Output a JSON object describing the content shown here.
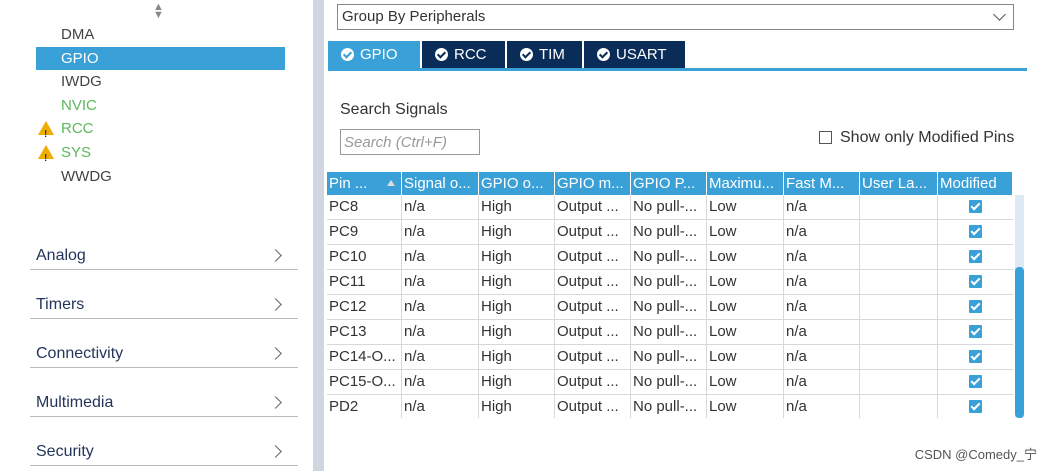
{
  "left": {
    "peripherals": [
      {
        "label": "DMA",
        "state": "normal"
      },
      {
        "label": "GPIO",
        "state": "selected"
      },
      {
        "label": "IWDG",
        "state": "normal"
      },
      {
        "label": "NVIC",
        "state": "green"
      },
      {
        "label": "RCC",
        "state": "warning"
      },
      {
        "label": "SYS",
        "state": "warning"
      },
      {
        "label": "WWDG",
        "state": "normal"
      }
    ],
    "categories": [
      "Analog",
      "Timers",
      "Connectivity",
      "Multimedia",
      "Security"
    ]
  },
  "right": {
    "group_by": "Group By Peripherals",
    "tabs": [
      "GPIO",
      "RCC",
      "TIM",
      "USART"
    ],
    "active_tab": "GPIO",
    "search_label": "Search Signals",
    "search_placeholder": "Search (Ctrl+F)",
    "show_modified_label": "Show only Modified Pins",
    "show_modified_checked": false
  },
  "table": {
    "columns": [
      "Pin ...",
      "Signal o...",
      "GPIO o...",
      "GPIO m...",
      "GPIO P...",
      "Maximu...",
      "Fast M...",
      "User La...",
      "Modified"
    ],
    "rows": [
      [
        "PC8",
        "n/a",
        "High",
        "Output ...",
        "No pull-...",
        "Low",
        "n/a",
        "",
        true
      ],
      [
        "PC9",
        "n/a",
        "High",
        "Output ...",
        "No pull-...",
        "Low",
        "n/a",
        "",
        true
      ],
      [
        "PC10",
        "n/a",
        "High",
        "Output ...",
        "No pull-...",
        "Low",
        "n/a",
        "",
        true
      ],
      [
        "PC11",
        "n/a",
        "High",
        "Output ...",
        "No pull-...",
        "Low",
        "n/a",
        "",
        true
      ],
      [
        "PC12",
        "n/a",
        "High",
        "Output ...",
        "No pull-...",
        "Low",
        "n/a",
        "",
        true
      ],
      [
        "PC13",
        "n/a",
        "High",
        "Output ...",
        "No pull-...",
        "Low",
        "n/a",
        "",
        true
      ],
      [
        "PC14-O...",
        "n/a",
        "High",
        "Output ...",
        "No pull-...",
        "Low",
        "n/a",
        "",
        true
      ],
      [
        "PC15-O...",
        "n/a",
        "High",
        "Output ...",
        "No pull-...",
        "Low",
        "n/a",
        "",
        true
      ],
      [
        "PD2",
        "n/a",
        "High",
        "Output ...",
        "No pull-...",
        "Low",
        "n/a",
        "",
        true
      ]
    ]
  },
  "watermark": "CSDN @Comedy_宁",
  "colors": {
    "accent": "#3aa0d8",
    "tab_dark": "#0a2c58",
    "warning": "#f0ad00",
    "green": "#5cb85c"
  }
}
